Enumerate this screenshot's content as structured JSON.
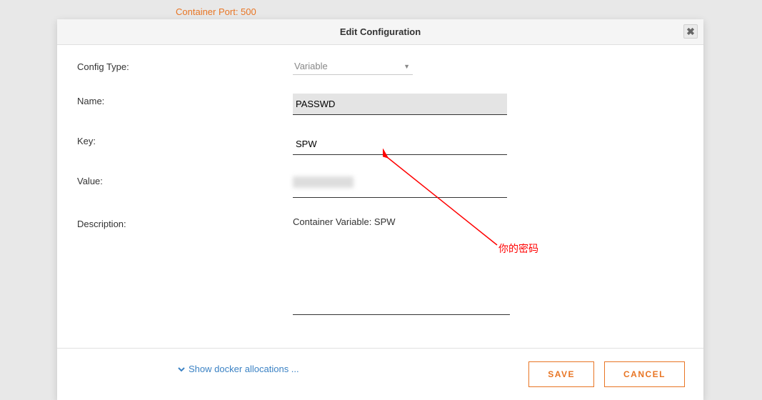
{
  "background": {
    "container_port_text": "Container Port: 500",
    "show_docker_text": "Show docker allocations ..."
  },
  "modal": {
    "title": "Edit Configuration",
    "labels": {
      "config_type": "Config Type:",
      "name": "Name:",
      "key": "Key:",
      "value": "Value:",
      "description": "Description:"
    },
    "values": {
      "config_type": "Variable",
      "name": "PASSWD",
      "key": "SPW",
      "value": "",
      "description": "Container Variable: SPW"
    },
    "buttons": {
      "save": "SAVE",
      "cancel": "CANCEL"
    }
  },
  "annotation": {
    "text": "你的密码"
  }
}
